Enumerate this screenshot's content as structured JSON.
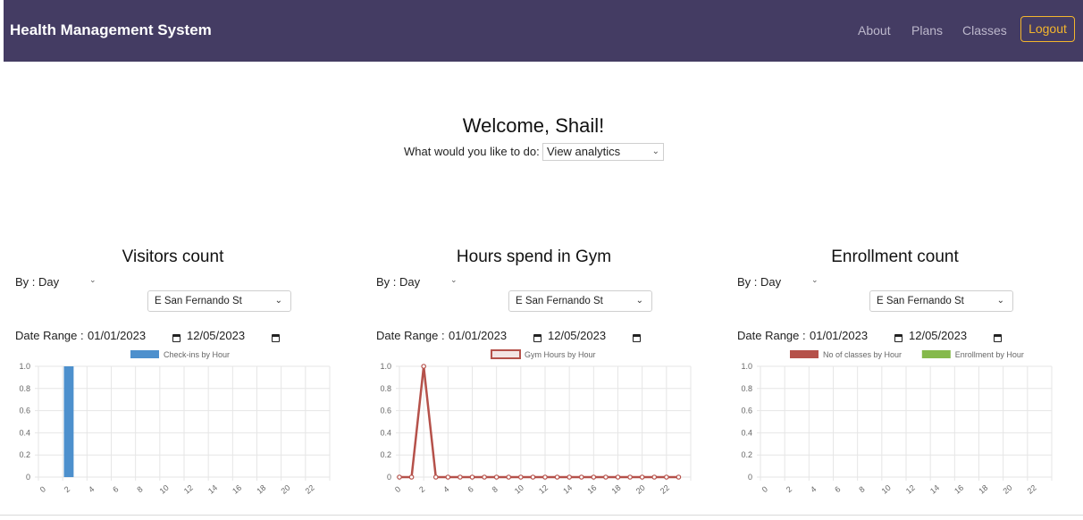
{
  "navbar": {
    "title": "Health Management System",
    "links": [
      "About",
      "Plans",
      "Classes"
    ],
    "logout_label": "Logout"
  },
  "welcome": {
    "greeting": "Welcome, Shail!",
    "prompt": "What would you like to do:",
    "selected_action": "View analytics"
  },
  "panels": [
    {
      "title": "Visitors count",
      "by": "By : Day",
      "location": "E San Fernando St",
      "date_range_label": "Date Range :",
      "start_date": "01/01/2023",
      "end_date": "12/05/2023"
    },
    {
      "title": "Hours spend in Gym",
      "by": "By : Day",
      "location": "E San Fernando St",
      "date_range_label": "Date Range :",
      "start_date": "01/01/2023",
      "end_date": "12/05/2023"
    },
    {
      "title": "Enrollment count",
      "by": "By : Day",
      "location": "E San Fernando St",
      "date_range_label": "Date Range :",
      "start_date": "01/01/2023",
      "end_date": "12/05/2023"
    }
  ],
  "chart_data": [
    {
      "type": "bar",
      "x": [
        0,
        1,
        2,
        3,
        4,
        5,
        6,
        7,
        8,
        9,
        10,
        11,
        12,
        13,
        14,
        15,
        16,
        17,
        18,
        19,
        20,
        21,
        22,
        23
      ],
      "x_tick_labels": [
        "0",
        "2",
        "4",
        "6",
        "8",
        "10",
        "12",
        "14",
        "16",
        "18",
        "20",
        "22"
      ],
      "ylim": [
        0,
        1
      ],
      "y_ticks": [
        "0",
        "0.2",
        "0.4",
        "0.6",
        "0.8",
        "1.0"
      ],
      "grid": true,
      "legend_position": "top",
      "series": [
        {
          "name": "Check-ins by Hour",
          "color": "#4d90cd",
          "values": [
            0,
            0,
            1,
            0,
            0,
            0,
            0,
            0,
            0,
            0,
            0,
            0,
            0,
            0,
            0,
            0,
            0,
            0,
            0,
            0,
            0,
            0,
            0,
            0
          ]
        }
      ]
    },
    {
      "type": "line",
      "x": [
        0,
        1,
        2,
        3,
        4,
        5,
        6,
        7,
        8,
        9,
        10,
        11,
        12,
        13,
        14,
        15,
        16,
        17,
        18,
        19,
        20,
        21,
        22,
        23
      ],
      "x_tick_labels": [
        "0",
        "2",
        "4",
        "6",
        "8",
        "10",
        "12",
        "14",
        "16",
        "18",
        "20",
        "22"
      ],
      "ylim": [
        0,
        1
      ],
      "y_ticks": [
        "0",
        "0.2",
        "0.4",
        "0.6",
        "0.8",
        "1.0"
      ],
      "grid": true,
      "legend_position": "top",
      "series": [
        {
          "name": "Gym Hours by Hour",
          "color": "#b5514a",
          "values": [
            0,
            0,
            1,
            0,
            0,
            0,
            0,
            0,
            0,
            0,
            0,
            0,
            0,
            0,
            0,
            0,
            0,
            0,
            0,
            0,
            0,
            0,
            0,
            0
          ]
        }
      ]
    },
    {
      "type": "bar",
      "x": [
        0,
        1,
        2,
        3,
        4,
        5,
        6,
        7,
        8,
        9,
        10,
        11,
        12,
        13,
        14,
        15,
        16,
        17,
        18,
        19,
        20,
        21,
        22,
        23
      ],
      "x_tick_labels": [
        "0",
        "2",
        "4",
        "6",
        "8",
        "10",
        "12",
        "14",
        "16",
        "18",
        "20",
        "22"
      ],
      "ylim": [
        0,
        1
      ],
      "y_ticks": [
        "0",
        "0.2",
        "0.4",
        "0.6",
        "0.8",
        "1.0"
      ],
      "grid": true,
      "legend_position": "top",
      "series": [
        {
          "name": "No of classes by Hour",
          "color": "#b5514a",
          "values": [
            0,
            0,
            0,
            0,
            0,
            0,
            0,
            0,
            0,
            0,
            0,
            0,
            0,
            0,
            0,
            0,
            0,
            0,
            0,
            0,
            0,
            0,
            0,
            0
          ]
        },
        {
          "name": "Enrollment by Hour",
          "color": "#85b94b",
          "values": [
            0,
            0,
            0,
            0,
            0,
            0,
            0,
            0,
            0,
            0,
            0,
            0,
            0,
            0,
            0,
            0,
            0,
            0,
            0,
            0,
            0,
            0,
            0,
            0
          ]
        }
      ]
    }
  ]
}
